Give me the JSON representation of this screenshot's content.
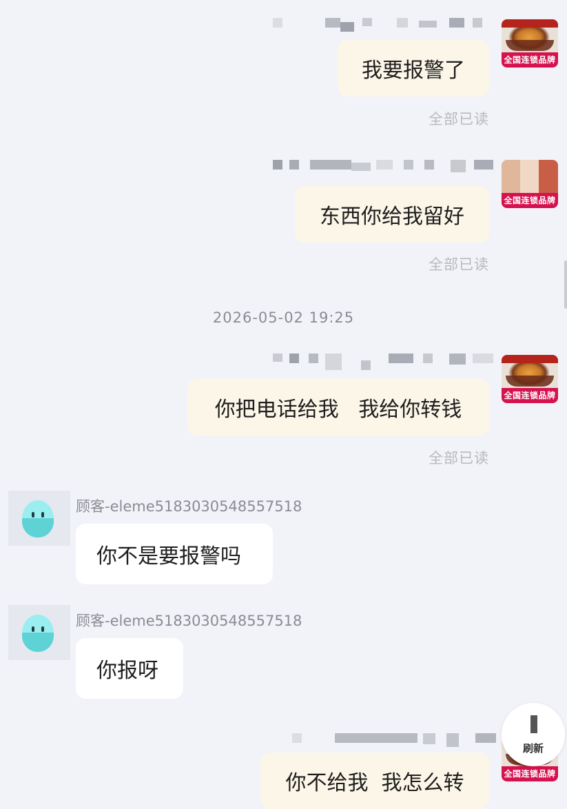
{
  "messages": [
    {
      "text": "我要报警了",
      "status": "全部已读"
    },
    {
      "text": "东西你给我留好",
      "status": "全部已读"
    },
    {
      "text": "你把电话给我   我给你转钱",
      "status": "全部已读"
    },
    {
      "text": "你不给我  我怎么转"
    }
  ],
  "timestamp": "2026-05-02 19:25",
  "customer": {
    "name": "顾客-eleme5183030548557518",
    "messages": [
      "你不是要报警吗",
      "你报呀"
    ]
  },
  "merchant": {
    "badge": "全国连锁品牌"
  },
  "refresh": {
    "label": "刷新"
  },
  "colors": {
    "background": "#f2f3f8",
    "outgoing_bubble": "#fcf6e8",
    "incoming_bubble": "#ffffff",
    "brand_badge": "#d5114e",
    "avatar_teal": "#5fd2d6"
  },
  "icons": {
    "customer_avatar": "masked-face-icon",
    "merchant_avatar": "food-dish-icon"
  }
}
